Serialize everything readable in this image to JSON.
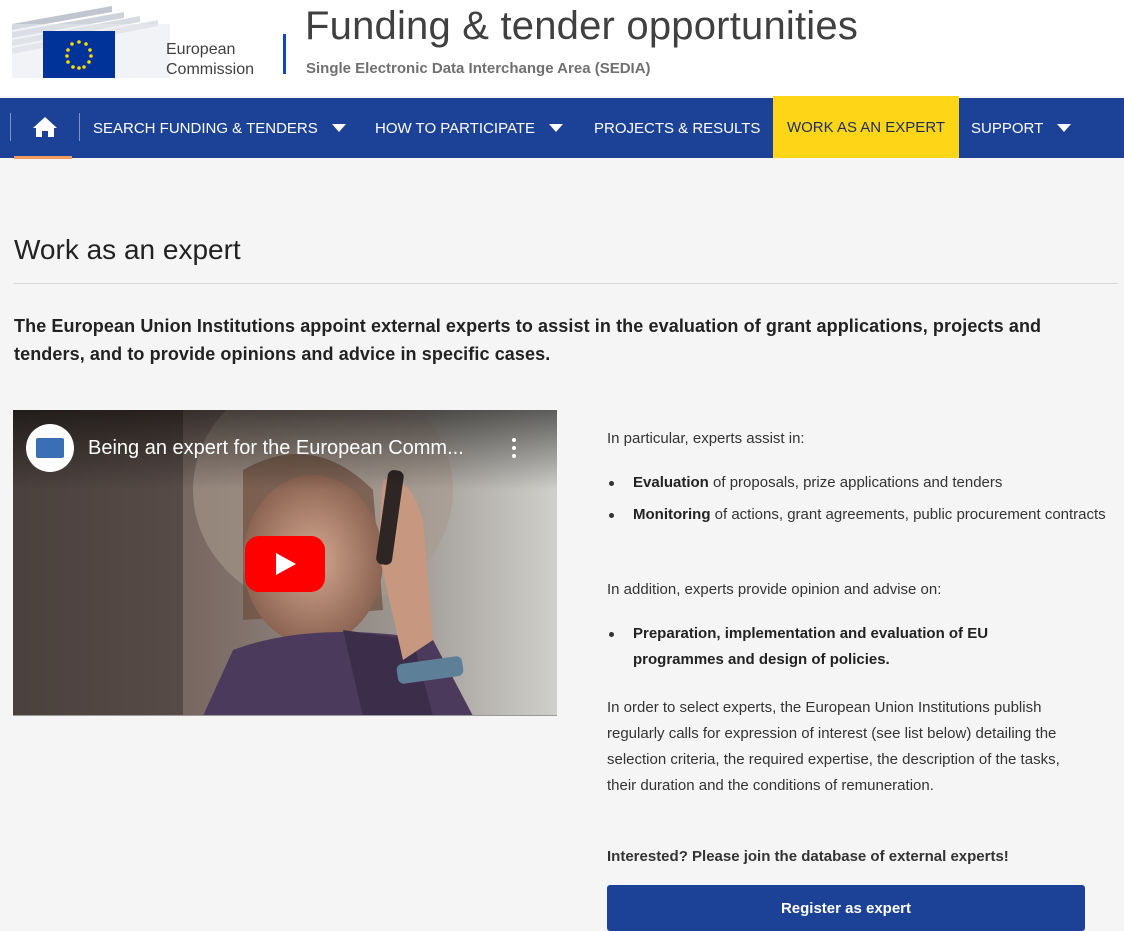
{
  "header": {
    "logo_line1": "European",
    "logo_line2": "Commission",
    "title": "Funding & tender opportunities",
    "subtitle": "Single Electronic Data Interchange Area (SEDIA)",
    "flag_color": "#003399"
  },
  "nav": {
    "home_icon": "home-icon",
    "items": [
      {
        "label": "SEARCH FUNDING & TENDERS",
        "dropdown": true,
        "active": false
      },
      {
        "label": "HOW TO PARTICIPATE",
        "dropdown": true,
        "active": false
      },
      {
        "label": "PROJECTS & RESULTS",
        "dropdown": false,
        "active": false
      },
      {
        "label": "WORK AS AN EXPERT",
        "dropdown": false,
        "active": true
      },
      {
        "label": "SUPPORT",
        "dropdown": true,
        "active": false
      }
    ],
    "bg_color": "#1c4297",
    "active_color": "#ffd617"
  },
  "main": {
    "page_title": "Work as an expert",
    "lead": "The European Union Institutions appoint external experts to assist in the evaluation of grant applications, projects and tenders, and to provide opinions and advice in specific cases.",
    "video": {
      "title": "Being an expert for the European Comm...",
      "play_icon": "youtube-play-icon"
    },
    "intro": "In particular, experts assist in:",
    "assist_items": [
      {
        "bold": "Evaluation",
        "rest": " of proposals, prize applications and tenders"
      },
      {
        "bold": "Monitoring",
        "rest": " of actions, grant agreements, public procurement contracts"
      }
    ],
    "addition": "In addition, experts provide opinion and advise on:",
    "advise_items": [
      {
        "bold": "Preparation, implementation and evaluation of EU programmes and design of policies.",
        "rest": ""
      }
    ],
    "selection_text": "In order to select experts, the European Union Institutions publish regularly calls for expression of interest (see list below) detailing the selection criteria, the required expertise, the description of the tasks, their duration and the conditions of remuneration.",
    "cta_text": "Interested? Please join the database of external experts!",
    "register_label": "Register as expert"
  }
}
